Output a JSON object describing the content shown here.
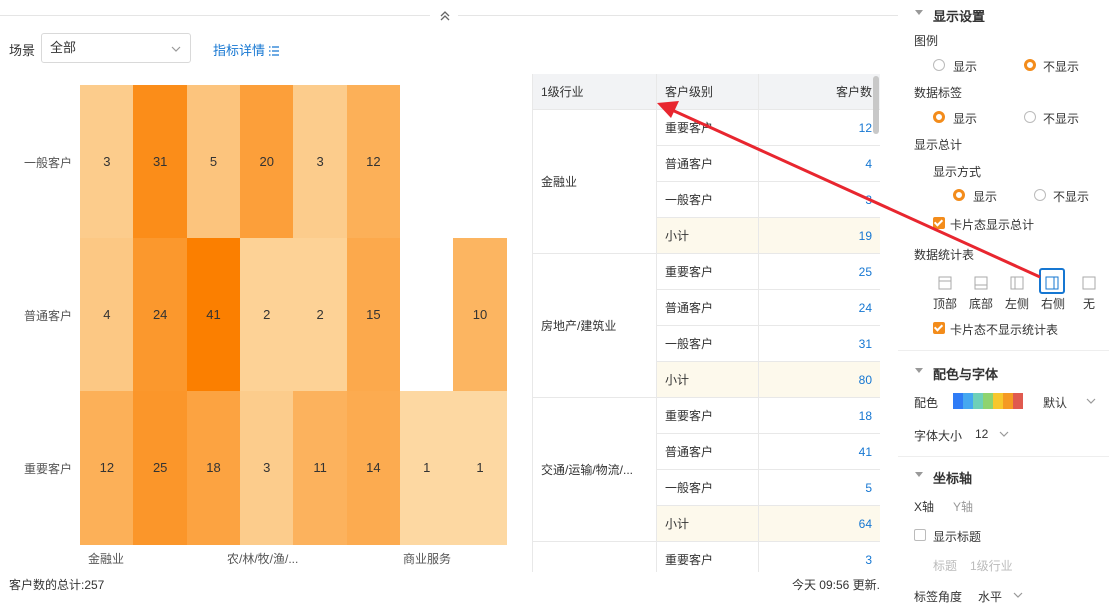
{
  "toolbar": {
    "scene_label": "场景",
    "scene_value": "全部",
    "metric_link": "指标详情"
  },
  "icons": {
    "collapse": "double-chevron-up-icon",
    "scene_dropdown": "chevron-down-icon",
    "metric_list": "list-icon"
  },
  "chart_data": {
    "type": "heatmap",
    "rows": [
      "一般客户",
      "普通客户",
      "重要客户"
    ],
    "x_tick_labels": [
      "金融业",
      "农/林/牧/渔/...",
      "商业服务"
    ],
    "columns": 8,
    "cells": [
      [
        3,
        31,
        5,
        20,
        3,
        12,
        null,
        null
      ],
      [
        4,
        24,
        41,
        2,
        2,
        15,
        null,
        10
      ],
      [
        12,
        25,
        18,
        3,
        11,
        14,
        1,
        1
      ]
    ],
    "color_range": [
      "#fde9c0",
      "#fb7f00"
    ],
    "empty_cells": [
      [
        0,
        6
      ],
      [
        0,
        7
      ],
      [
        1,
        6
      ]
    ],
    "empty_color": [
      "#ffffff",
      "#ffffff",
      "#f5f6f9"
    ]
  },
  "footer": {
    "total": "客户数的总计:257",
    "updated": "今天 09:56 更新."
  },
  "table": {
    "headers": [
      "1级行业",
      "客户级别",
      "客户数"
    ],
    "groups": [
      {
        "industry": "金融业",
        "rows": [
          {
            "level": "重要客户",
            "count": "12"
          },
          {
            "level": "普通客户",
            "count": "4"
          },
          {
            "level": "一般客户",
            "count": "3"
          },
          {
            "level": "小计",
            "count": "19",
            "subtotal": true
          }
        ]
      },
      {
        "industry": "房地产/建筑业",
        "rows": [
          {
            "level": "重要客户",
            "count": "25"
          },
          {
            "level": "普通客户",
            "count": "24"
          },
          {
            "level": "一般客户",
            "count": "31"
          },
          {
            "level": "小计",
            "count": "80",
            "subtotal": true
          }
        ]
      },
      {
        "industry": "交通/运输/物流/...",
        "rows": [
          {
            "level": "重要客户",
            "count": "18"
          },
          {
            "level": "普通客户",
            "count": "41"
          },
          {
            "level": "一般客户",
            "count": "5"
          },
          {
            "level": "小计",
            "count": "64",
            "subtotal": true
          }
        ]
      },
      {
        "industry": "",
        "rows": [
          {
            "level": "重要客户",
            "count": "3"
          }
        ]
      }
    ]
  },
  "panel": {
    "display": {
      "title": "显示设置",
      "legend_label": "图例",
      "legend_show": "显示",
      "legend_hide": "不显示",
      "legend_selected": "不显示",
      "datalabel_label": "数据标签",
      "datalabel_show": "显示",
      "datalabel_hide": "不显示",
      "datalabel_selected": "显示",
      "total_label": "显示总计",
      "total_mode_label": "显示方式",
      "total_show": "显示",
      "total_hide": "不显示",
      "total_selected": "显示",
      "card_total": "卡片态显示总计",
      "card_total_checked": true,
      "stat_table_label": "数据统计表",
      "positions": [
        "顶部",
        "底部",
        "左侧",
        "右侧",
        "无"
      ],
      "position_selected": "右侧",
      "card_no_table": "卡片态不显示统计表",
      "card_no_table_checked": true
    },
    "color_font": {
      "title": "配色与字体",
      "palette_label": "配色",
      "palette_value": "默认",
      "palette_colors": [
        "#2f7cf6",
        "#45a8f0",
        "#6dd0b8",
        "#8ed36f",
        "#f7c72c",
        "#f59a23",
        "#e05a4f"
      ],
      "font_size_label": "字体大小",
      "font_size_value": "12"
    },
    "axis": {
      "title": "坐标轴",
      "tab_x": "X轴",
      "tab_y": "Y轴",
      "show_title": "显示标题",
      "show_title_checked": false,
      "title_label": "标题",
      "title_placeholder": "1级行业",
      "angle_label": "标签角度",
      "angle_value": "水平"
    }
  },
  "colors": {
    "accent": "#f38c1b",
    "link": "#1677d2",
    "annotation_arrow": "#e8262f"
  }
}
